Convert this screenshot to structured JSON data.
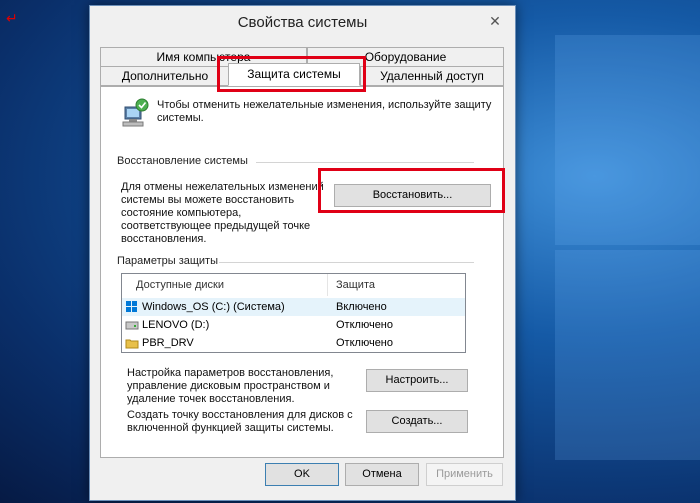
{
  "window": {
    "title": "Свойства системы",
    "close_symbol": "✕"
  },
  "tabs": {
    "row1": [
      "Имя компьютера",
      "Оборудование"
    ],
    "row2": [
      "Дополнительно",
      "Защита системы",
      "Удаленный доступ"
    ],
    "active": "Защита системы"
  },
  "intro": "Чтобы отменить нежелательные изменения, используйте защиту системы.",
  "restore": {
    "section_label": "Восстановление системы",
    "description": [
      "Для отмены нежелательных изменений",
      "системы вы можете восстановить",
      "состояние компьютера,",
      "соответствующее предыдущей точке",
      "восстановления."
    ],
    "button": "Восстановить..."
  },
  "protection": {
    "section_label": "Параметры защиты",
    "columns": [
      "Доступные диски",
      "Защита"
    ],
    "rows": [
      {
        "name": "Windows_OS (C:) (Система)",
        "status": "Включено",
        "icon": "system-drive-icon"
      },
      {
        "name": "LENOVO (D:)",
        "status": "Отключено",
        "icon": "drive-icon"
      },
      {
        "name": "PBR_DRV",
        "status": "Отключено",
        "icon": "folder-icon"
      }
    ],
    "configure_text": [
      "Настройка параметров восстановления,",
      "управление дисковым пространством и",
      "удаление точек восстановления."
    ],
    "configure_button": "Настроить...",
    "create_text": [
      "Создать точку восстановления для дисков с",
      "включенной функцией защиты системы."
    ],
    "create_button": "Создать..."
  },
  "footer": {
    "ok": "OK",
    "cancel": "Отмена",
    "apply": "Применить"
  },
  "highlight_color": "#e00016"
}
